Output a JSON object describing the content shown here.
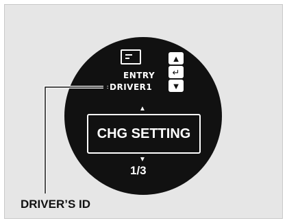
{
  "display": {
    "entry_label": "ENTRY",
    "driver_label": "DRIVER1",
    "setting_label": "CHG SETTING",
    "page_indicator": "1/3",
    "nav": {
      "up_icon": "▲",
      "enter_icon": "↵",
      "down_icon": "▼"
    },
    "screen_icon": "screen-entry-icon"
  },
  "callout": {
    "caption": "DRIVER’S ID"
  },
  "colors": {
    "background": "#e6e6e6",
    "display": "#111111",
    "text_on_display": "#ffffff"
  }
}
